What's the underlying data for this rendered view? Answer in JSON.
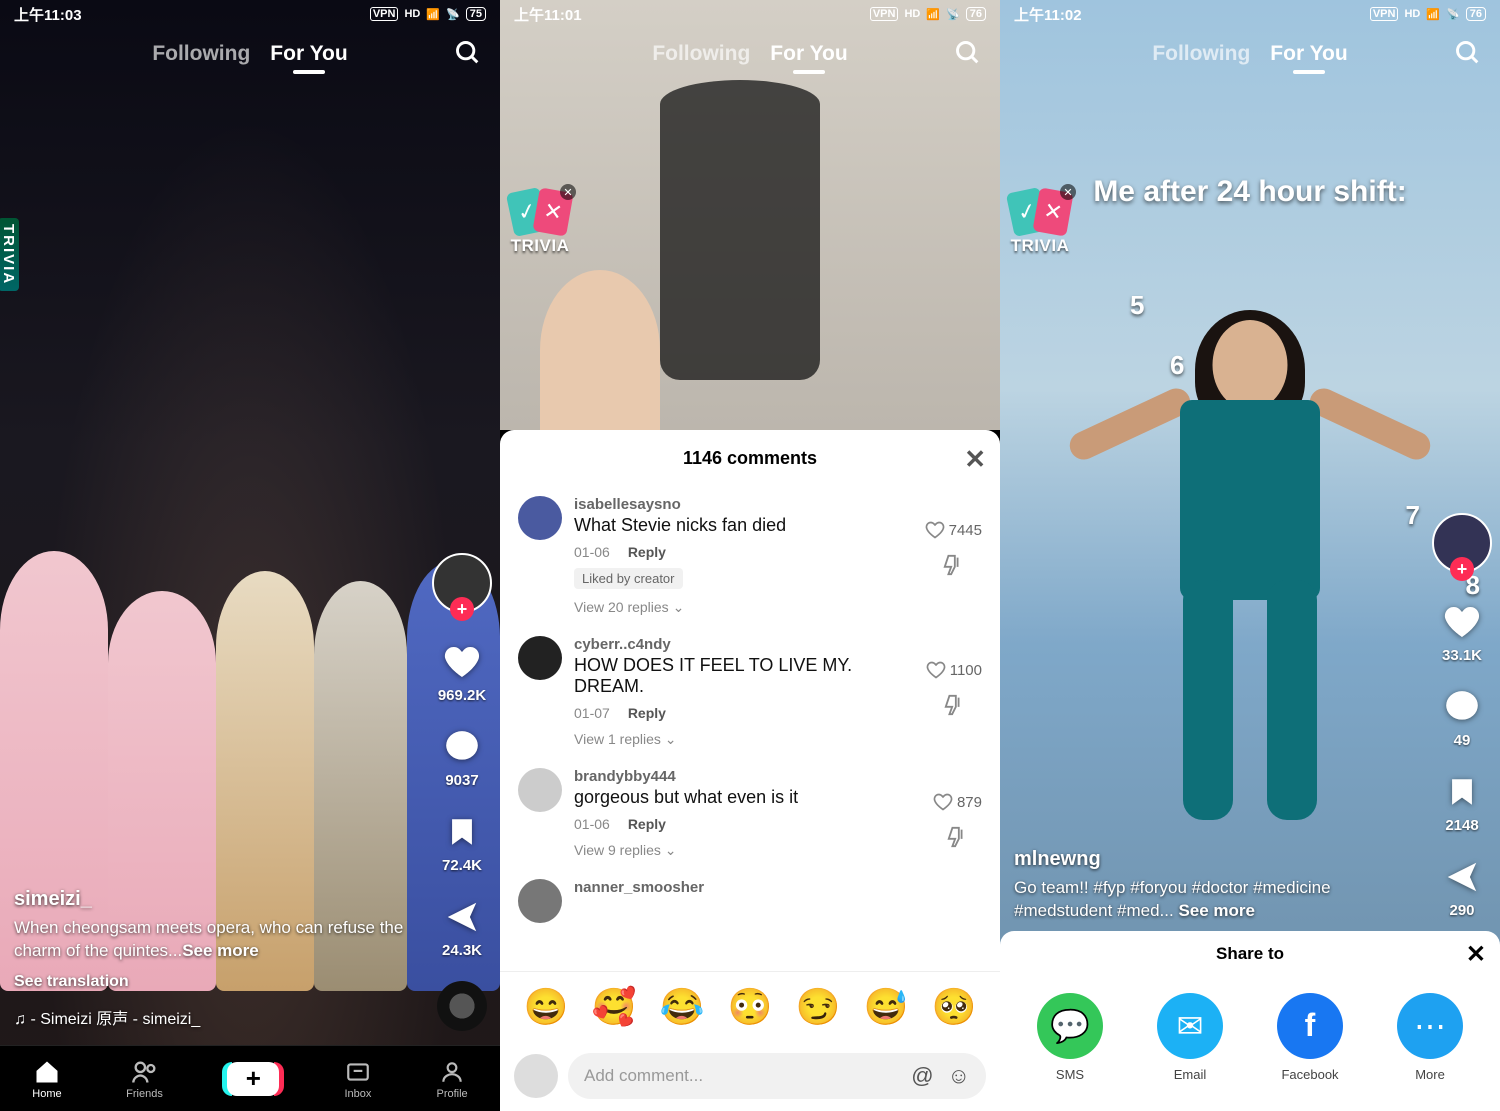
{
  "phones": [
    {
      "status": {
        "time": "上午11:03",
        "battery": "75"
      },
      "nav": {
        "following": "Following",
        "foryou": "For You"
      },
      "trivia": "TRIVIA",
      "rail": {
        "likes": "969.2K",
        "comments": "9037",
        "saves": "72.4K",
        "shares": "24.3K"
      },
      "caption": {
        "user": "simeizi_",
        "desc": "When cheongsam meets opera, who can refuse the charm of the quintes...",
        "seemore": "See more",
        "translate": "See translation",
        "music": "♫ - Simeizi  原声 - simeizi_"
      },
      "navbar": {
        "home": "Home",
        "friends": "Friends",
        "inbox": "Inbox",
        "profile": "Profile"
      }
    },
    {
      "status": {
        "time": "上午11:01",
        "battery": "76"
      },
      "nav": {
        "following": "Following",
        "foryou": "For You"
      },
      "trivia": "TRIVIA",
      "commentsHeader": "1146 comments",
      "comments": [
        {
          "user": "isabellesaysno",
          "text": "What Stevie nicks fan died",
          "date": "01-06",
          "reply": "Reply",
          "likes": "7445",
          "liked_by": "Liked by creator",
          "viewreplies": "View 20 replies ⌄"
        },
        {
          "user": "cyberr..c4ndy",
          "text": "HOW DOES IT FEEL TO LIVE MY. DREAM.",
          "date": "01-07",
          "reply": "Reply",
          "likes": "1100",
          "viewreplies": "View 1 replies ⌄"
        },
        {
          "user": "brandybby444",
          "text": "gorgeous but what even is it",
          "date": "01-06",
          "reply": "Reply",
          "likes": "879",
          "viewreplies": "View 9 replies ⌄"
        },
        {
          "user": "nanner_smoosher",
          "text": ""
        }
      ],
      "emojiReacts": [
        "😄",
        "🥰",
        "😂",
        "😳",
        "😏",
        "😅",
        "🥺"
      ],
      "input": {
        "placeholder": "Add comment...",
        "at": "@",
        "emoji": "☺"
      }
    },
    {
      "status": {
        "time": "上午11:02",
        "battery": "76"
      },
      "nav": {
        "following": "Following",
        "foryou": "For You"
      },
      "trivia": "TRIVIA",
      "overlayText": "Me after 24 hour shift:",
      "numbers": [
        "5",
        "6",
        "7",
        "8"
      ],
      "rail": {
        "likes": "33.1K",
        "comments": "49",
        "saves": "2148",
        "shares": "290"
      },
      "caption": {
        "user": "mlnewng",
        "desc": "Go team!! #fyp #foryou #doctor #medicine #medstudent #med...",
        "seemore": "See more"
      },
      "share": {
        "title": "Share to",
        "items": [
          {
            "label": "SMS",
            "icon": "💬"
          },
          {
            "label": "Email",
            "icon": "✉"
          },
          {
            "label": "Facebook",
            "icon": "f"
          },
          {
            "label": "More",
            "icon": "⋯"
          }
        ]
      }
    }
  ]
}
